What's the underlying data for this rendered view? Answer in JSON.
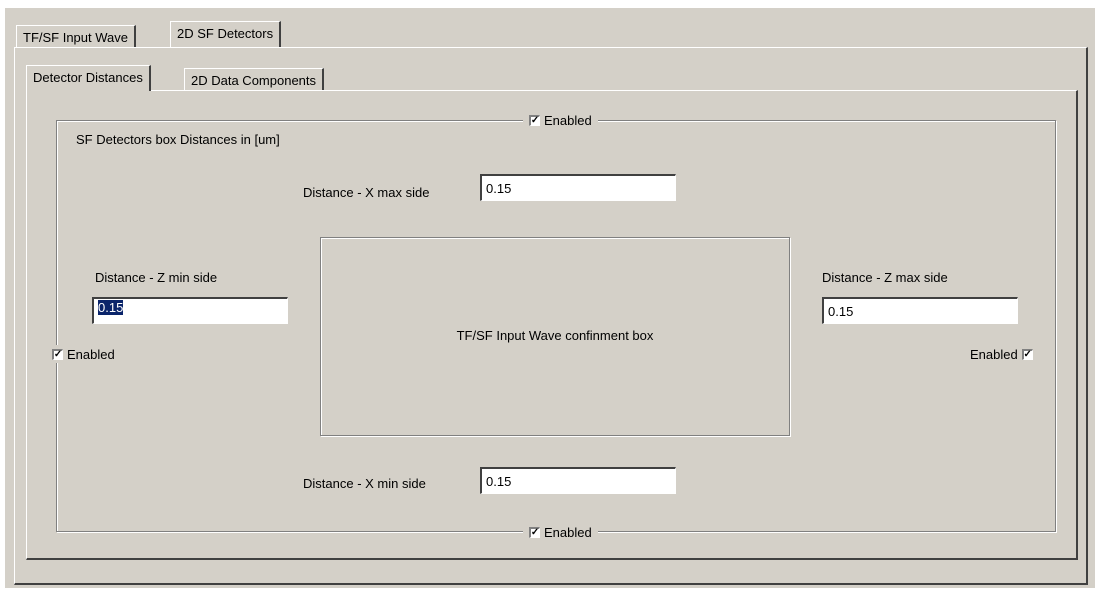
{
  "tabs": {
    "outer": [
      "TF/SF Input Wave",
      "2D SF Detectors"
    ],
    "inner": [
      "Detector Distances",
      "2D Data Components"
    ]
  },
  "group": {
    "title": "SF Detectors box Distances in [um]",
    "top_check": "Enabled",
    "bottom_check": "Enabled",
    "left_check": "Enabled",
    "right_check": "Enabled",
    "check_mark": "✓"
  },
  "fields": {
    "x_max": {
      "label": "Distance - X max side",
      "value": "0.15"
    },
    "x_min": {
      "label": "Distance - X min side",
      "value": "0.15"
    },
    "z_min": {
      "label": "Distance - Z min side",
      "value": "0.15"
    },
    "z_max": {
      "label": "Distance - Z max side",
      "value": "0.15"
    }
  },
  "confinement_box": {
    "label": "TF/SF Input Wave confinment box"
  }
}
